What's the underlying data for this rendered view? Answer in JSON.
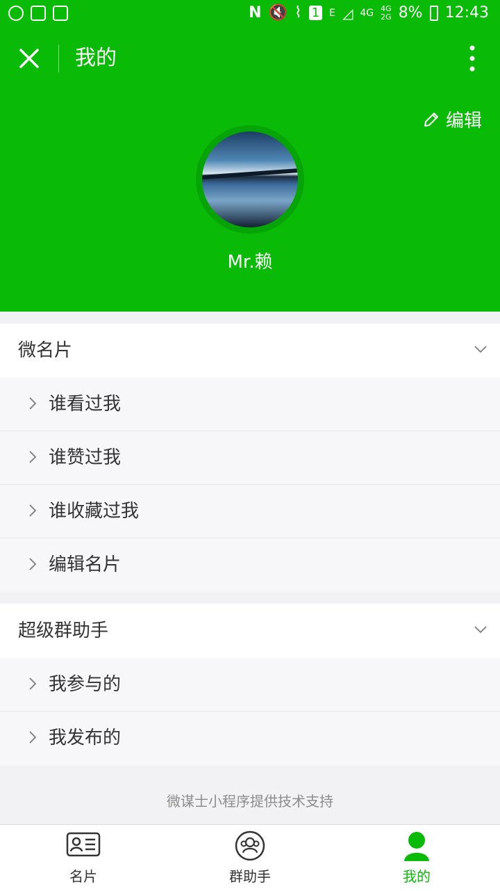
{
  "status_bar": {
    "network_4g": "4G",
    "network_4g_2g_top": "4G",
    "network_4g_2g_bottom": "2G",
    "edge": "E",
    "sim": "1",
    "battery": "8%",
    "time": "12:43"
  },
  "nav": {
    "title": "我的"
  },
  "profile": {
    "edit_label": "编辑",
    "username": "Mr.赖"
  },
  "sections": [
    {
      "title": "微名片",
      "items": [
        {
          "label": "谁看过我"
        },
        {
          "label": "谁赞过我"
        },
        {
          "label": "谁收藏过我"
        },
        {
          "label": "编辑名片"
        }
      ]
    },
    {
      "title": "超级群助手",
      "items": [
        {
          "label": "我参与的"
        },
        {
          "label": "我发布的"
        }
      ]
    }
  ],
  "footer": {
    "note": "微谋士小程序提供技术支持"
  },
  "tabbar": {
    "tabs": [
      {
        "label": "名片",
        "icon": "card-icon"
      },
      {
        "label": "群助手",
        "icon": "group-icon"
      },
      {
        "label": "我的",
        "icon": "user-icon"
      }
    ],
    "active_index": 2
  },
  "colors": {
    "brand_green": "#09bb07",
    "background": "#f2f2f4"
  }
}
